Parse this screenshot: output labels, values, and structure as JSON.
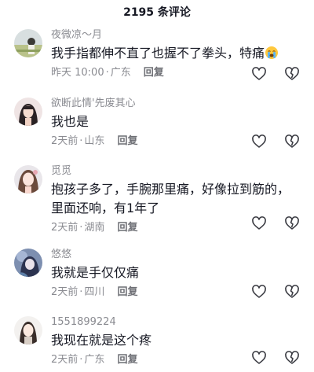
{
  "header": {
    "title": "2195 条评论"
  },
  "comments": [
    {
      "username": "夜微凉～月",
      "text": "我手指都伸不直了也握不了拳头，特痛",
      "emoji": "crying-emoji",
      "time": "昨天 10:00",
      "location": "广东",
      "reply": "回复"
    },
    {
      "username": "欲断此情'先废其心",
      "text": "我也是",
      "time": "2天前",
      "location": "山东",
      "reply": "回复"
    },
    {
      "username": "觅觅",
      "text": "抱孩子多了，手腕那里痛，好像拉到筋的，",
      "text2": "里面还响，有1年了",
      "time": "2天前",
      "location": "湖南",
      "reply": "回复"
    },
    {
      "username": "悠悠",
      "text": "我就是手仅仅痛",
      "time": "2天前",
      "location": "四川",
      "reply": "回复"
    },
    {
      "username": "1551899224",
      "text": "我现在就是这个疼",
      "time": "2天前",
      "location": "广东",
      "reply": "回复"
    }
  ],
  "meta_separator": "·",
  "colors": {
    "text": "#161823",
    "muted": "#8a8b91",
    "icon": "#3a3b42"
  }
}
